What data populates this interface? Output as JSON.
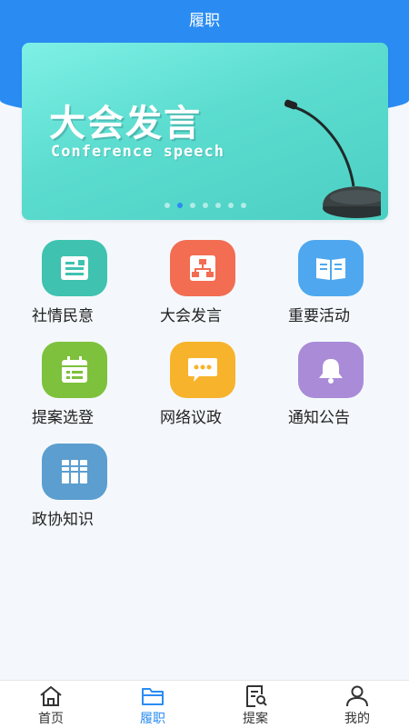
{
  "header": {
    "title": "履职"
  },
  "banner": {
    "title": "大会发言",
    "subtitle": "Conference speech",
    "dot_count": 7,
    "active_dot": 1
  },
  "grid": {
    "items": [
      {
        "label": "社情民意",
        "icon": "document-icon",
        "color": "#3fc2b0"
      },
      {
        "label": "大会发言",
        "icon": "hierarchy-icon",
        "color": "#f26d52"
      },
      {
        "label": "重要活动",
        "icon": "book-icon",
        "color": "#4fa8ef"
      },
      {
        "label": "提案选登",
        "icon": "calendar-list-icon",
        "color": "#7ec13c"
      },
      {
        "label": "网络议政",
        "icon": "chat-bubble-icon",
        "color": "#f7b32b"
      },
      {
        "label": "通知公告",
        "icon": "bell-icon",
        "color": "#a98bd8"
      },
      {
        "label": "政协知识",
        "icon": "binders-icon",
        "color": "#5b9ecf"
      }
    ]
  },
  "tabbar": {
    "items": [
      {
        "label": "首页",
        "icon": "home-icon",
        "active": false
      },
      {
        "label": "履职",
        "icon": "folder-icon",
        "active": true
      },
      {
        "label": "提案",
        "icon": "document-search-icon",
        "active": false
      },
      {
        "label": "我的",
        "icon": "user-icon",
        "active": false
      }
    ]
  },
  "colors": {
    "primary": "#2a8cf3",
    "background": "#f4f8fc"
  }
}
